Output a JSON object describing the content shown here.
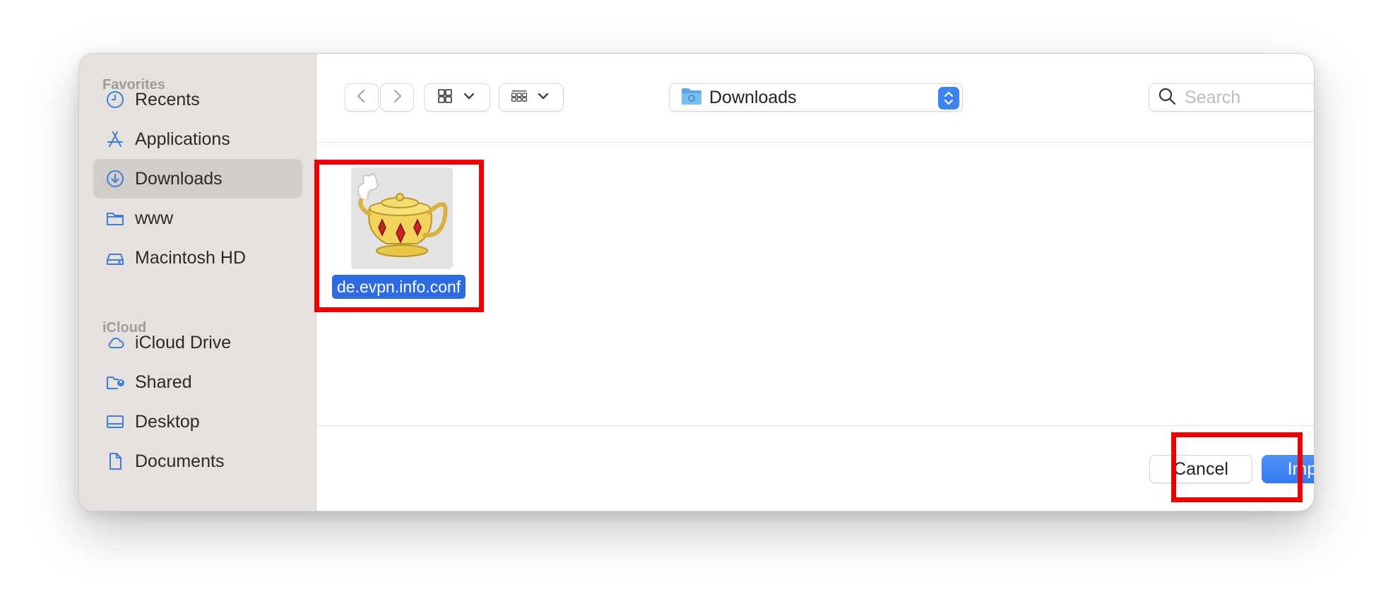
{
  "sidebar": {
    "favorites_heading": "Favorites",
    "favorites": [
      {
        "label": "Recents",
        "icon": "clock-icon"
      },
      {
        "label": "Applications",
        "icon": "applications-icon"
      },
      {
        "label": "Downloads",
        "icon": "download-circle-icon",
        "selected": true
      },
      {
        "label": "www",
        "icon": "folder-icon"
      },
      {
        "label": "Macintosh HD",
        "icon": "hard-drive-icon"
      }
    ],
    "icloud_heading": "iCloud",
    "icloud": [
      {
        "label": "iCloud Drive",
        "icon": "cloud-icon"
      },
      {
        "label": "Shared",
        "icon": "shared-folder-icon"
      },
      {
        "label": "Desktop",
        "icon": "desktop-icon"
      },
      {
        "label": "Documents",
        "icon": "document-icon"
      }
    ]
  },
  "toolbar": {
    "location": "Downloads",
    "search_placeholder": "Search"
  },
  "files": [
    {
      "name": "de.evpn.info.conf",
      "icon": "genie-lamp-icon",
      "selected": true
    }
  ],
  "footer": {
    "cancel_label": "Cancel",
    "import_label": "Import"
  },
  "colors": {
    "accent": "#3478f0",
    "selection": "#2e6ae0",
    "highlight": "#ee0000"
  }
}
